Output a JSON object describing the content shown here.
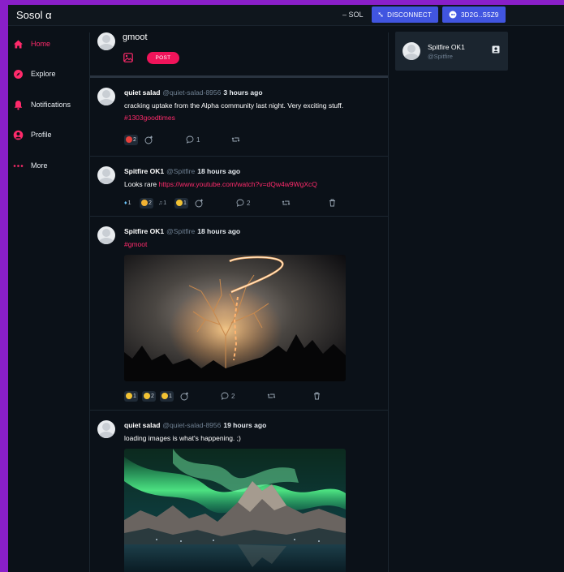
{
  "app": {
    "title": "Sosol α"
  },
  "topbar": {
    "sol": "– SOL",
    "disconnect_label": "DISCONNECT",
    "wallet_label": "3D2G..S5Z9"
  },
  "sidebar": {
    "items": [
      {
        "label": "Home",
        "icon": "home-icon",
        "active": true
      },
      {
        "label": "Explore",
        "icon": "compass-icon"
      },
      {
        "label": "Notifications",
        "icon": "bell-icon"
      },
      {
        "label": "Profile",
        "icon": "user-icon"
      },
      {
        "label": "More",
        "icon": "more-icon"
      }
    ]
  },
  "compose": {
    "name": "gmoot",
    "post_label": "POST"
  },
  "posts": [
    {
      "author": "quiet salad",
      "handle": "@quiet-salad-8956",
      "time": "3 hours ago",
      "text": "cracking uptake from the Alpha community last night. Very exciting stuff.",
      "tag": "#1303goodtimes",
      "reactions": [
        {
          "count": "2"
        }
      ],
      "comments": "1"
    },
    {
      "author": "Spitfire OK1",
      "handle": "@Spitfire",
      "time": "18 hours ago",
      "text": "Looks rare ",
      "link": "https://www.youtube.com/watch?v=dQw4w9WgXcQ",
      "reactions": [
        {
          "count": "1"
        },
        {
          "count": "2"
        },
        {
          "count": "1"
        },
        {
          "count": "1"
        }
      ],
      "comments": "2"
    },
    {
      "author": "Spitfire OK1",
      "handle": "@Spitfire",
      "time": "18 hours ago",
      "tag": "#gmoot",
      "reactions": [
        {
          "count": "1"
        },
        {
          "count": "2"
        },
        {
          "count": "1"
        }
      ],
      "comments": "2"
    },
    {
      "author": "quiet salad",
      "handle": "@quiet-salad-8956",
      "time": "19 hours ago",
      "text": "loading images is what's happening. ;)"
    }
  ],
  "right_panel": {
    "name": "Spitfire OK1",
    "handle": "@Spitfire"
  },
  "colors": {
    "accent": "#ff2a6b",
    "button_blue": "#4155e0",
    "background": "#0b1118",
    "frame": "#8a1fc9"
  }
}
